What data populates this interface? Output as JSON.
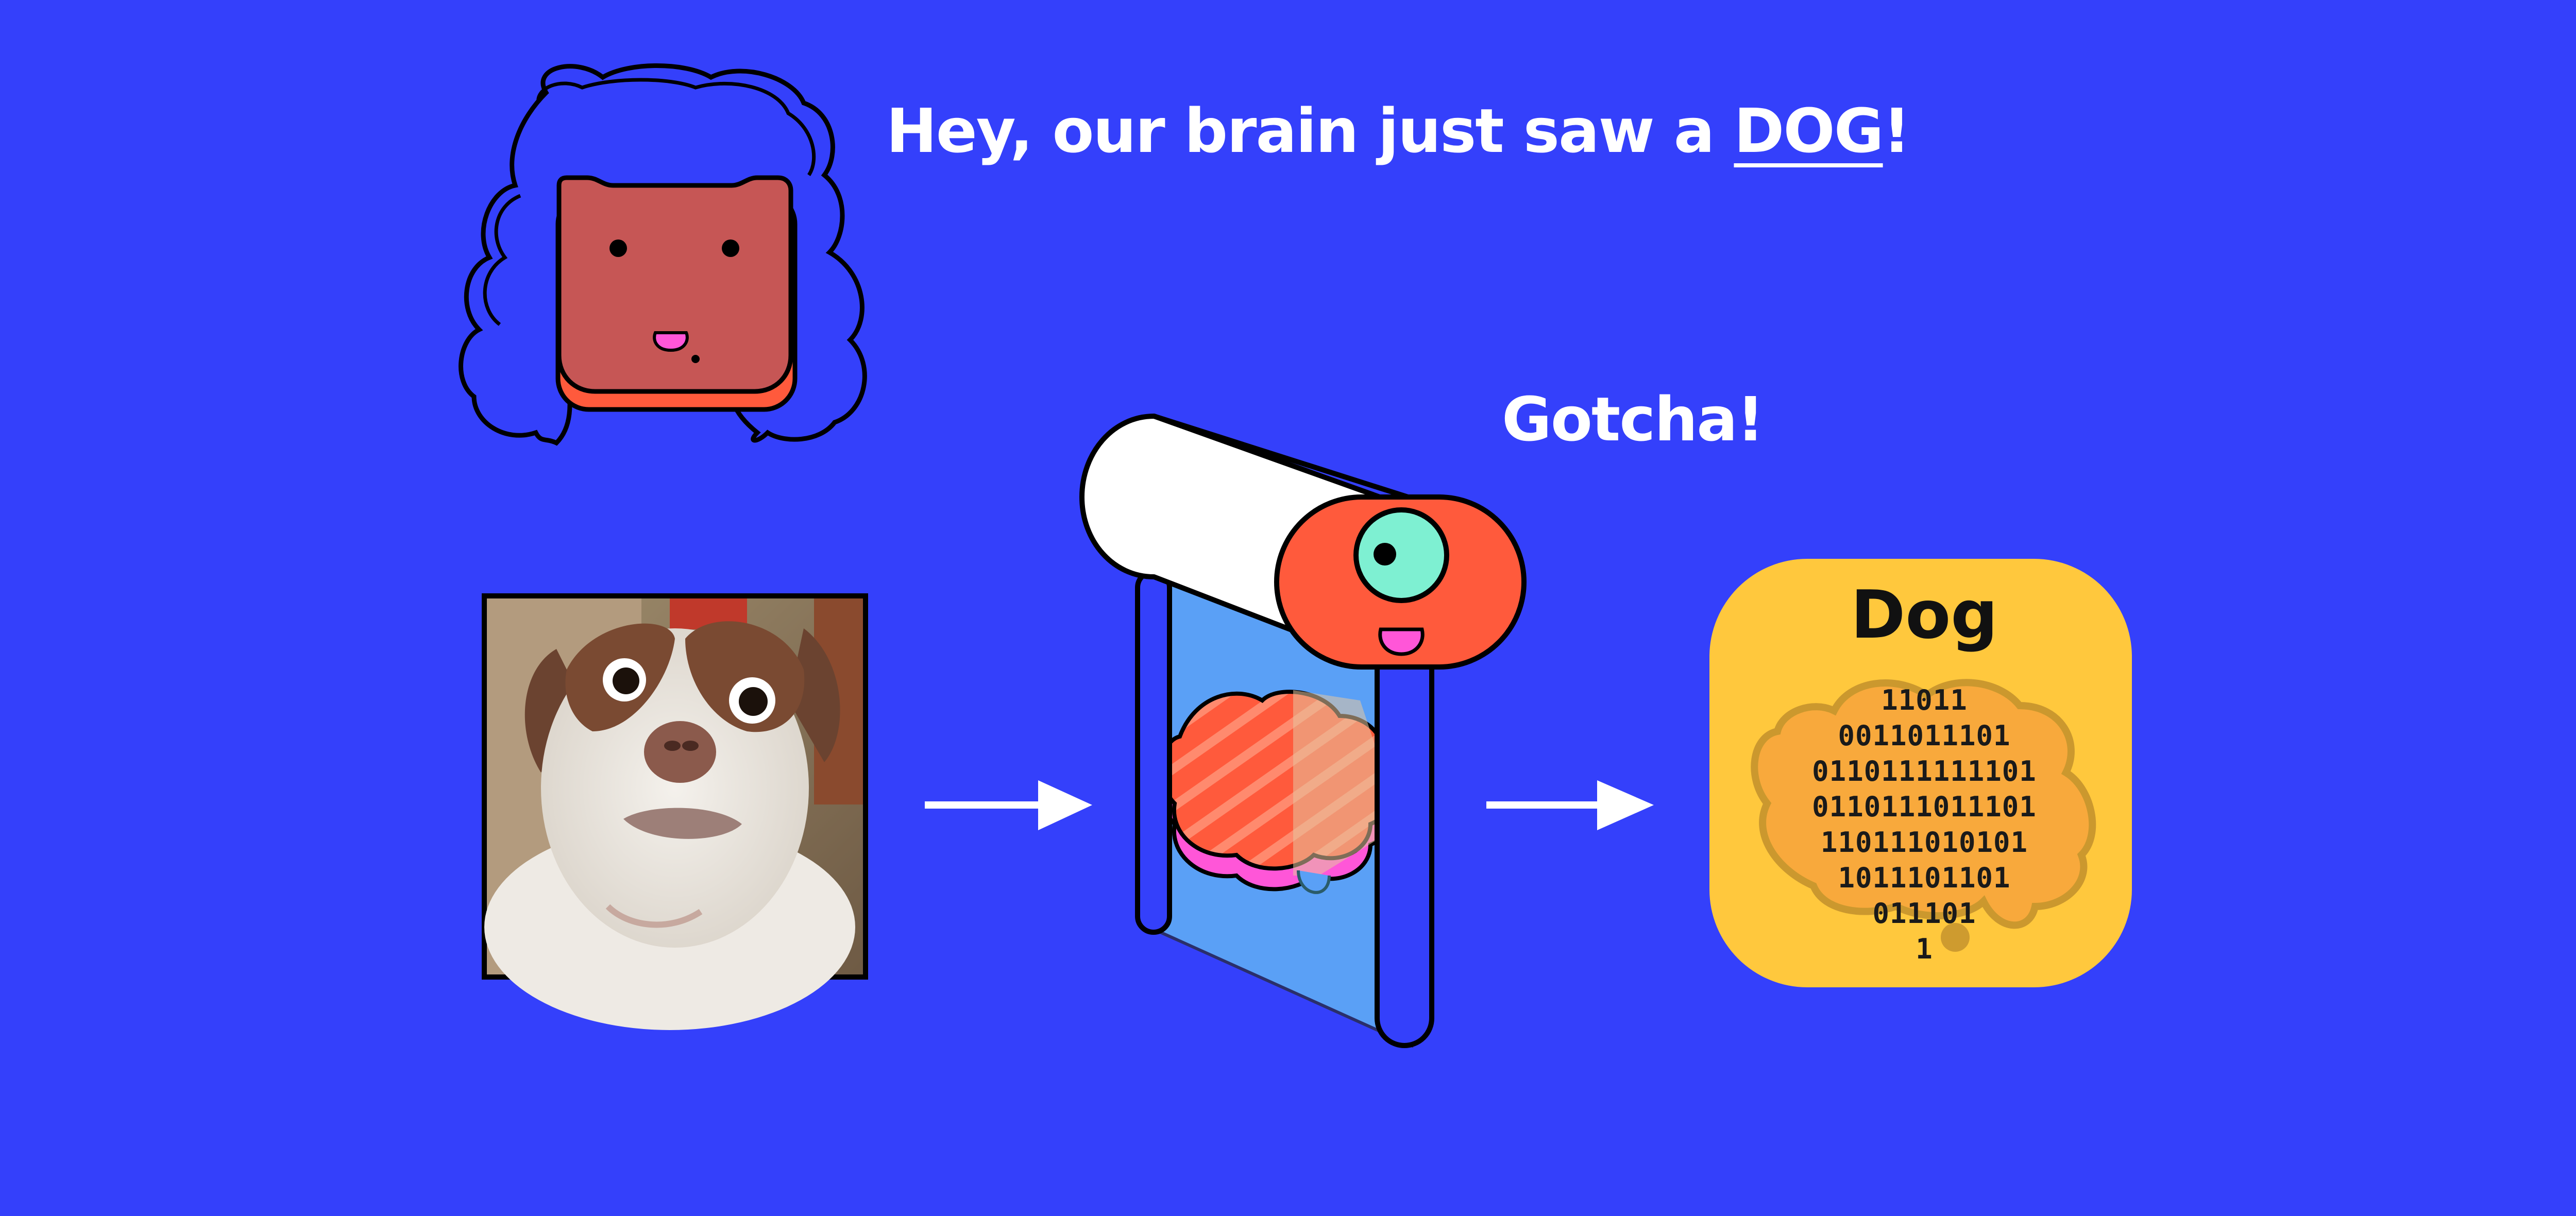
{
  "headline": {
    "prefix": "Hey, our brain just saw a ",
    "emphasis": "DOG",
    "suffix": "!"
  },
  "speech": {
    "robot": "Gotcha!"
  },
  "output_card": {
    "label": "Dog",
    "binary_lines": [
      "11011",
      "0011011101",
      "0110111111101",
      "0110111011101",
      "110111010101",
      "1011101101",
      "011101",
      "1"
    ]
  },
  "colors": {
    "background": "#3440fb",
    "card": "#ffc83d",
    "robot_head": "#ff5a3c",
    "robot_eye": "#7ef0d2",
    "brain": "#ff5a3c",
    "face": "#c65655"
  },
  "icons": [
    "person-head-icon",
    "dog-photo",
    "arrow-right-icon",
    "scanner-robot-icon",
    "brain-icon",
    "binary-brain-icon"
  ]
}
